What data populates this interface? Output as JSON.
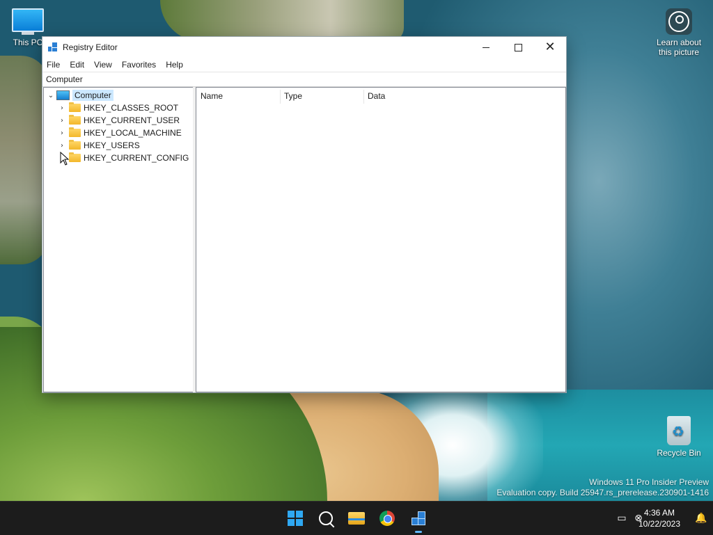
{
  "desktop": {
    "icons": [
      {
        "label": "This PC"
      },
      {
        "label": "Learn about this picture"
      },
      {
        "label": "Recycle Bin"
      }
    ],
    "watermark": {
      "line1": "Windows 11 Pro Insider Preview",
      "line2": "Evaluation copy. Build 25947.rs_prerelease.230901-1416"
    }
  },
  "window": {
    "title": "Registry Editor",
    "menu": [
      "File",
      "Edit",
      "View",
      "Favorites",
      "Help"
    ],
    "address": "Computer",
    "tree": {
      "root": "Computer",
      "keys": [
        "HKEY_CLASSES_ROOT",
        "HKEY_CURRENT_USER",
        "HKEY_LOCAL_MACHINE",
        "HKEY_USERS",
        "HKEY_CURRENT_CONFIG"
      ]
    },
    "columns": [
      "Name",
      "Type",
      "Data"
    ]
  },
  "taskbar": {
    "apps": [
      "start-icon",
      "search-icon",
      "file-explorer-icon",
      "chrome-icon",
      "registry-editor-icon"
    ],
    "clock": {
      "time": "4:36 AM",
      "date": "10/22/2023"
    }
  }
}
